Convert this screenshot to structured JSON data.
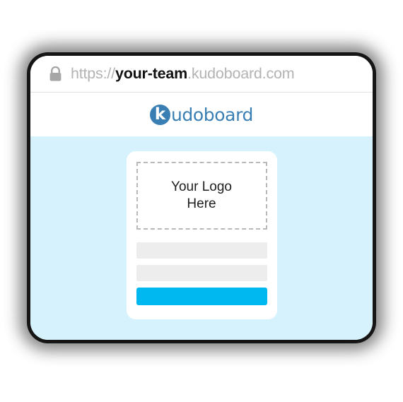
{
  "browser": {
    "lock_icon": "lock-icon",
    "url": {
      "scheme": "https://",
      "subdomain": "your-team",
      "domain": ".kudoboard.com",
      "full": "https://your-team.kudoboard.com"
    }
  },
  "site_header": {
    "logo_mark_letter": "k",
    "logo_text": "udoboard",
    "brand_name": "Kudoboard",
    "brand_color": "#3a7fb4"
  },
  "page": {
    "background_color": "#d6f2fd"
  },
  "card": {
    "logo_placeholder": {
      "line1": "Your Logo",
      "line2": "Here"
    },
    "fields": [
      {
        "name": "field-one",
        "value": "",
        "placeholder": ""
      },
      {
        "name": "field-two",
        "value": "",
        "placeholder": ""
      }
    ],
    "submit": {
      "label": "",
      "color": "#00b8f0"
    }
  }
}
